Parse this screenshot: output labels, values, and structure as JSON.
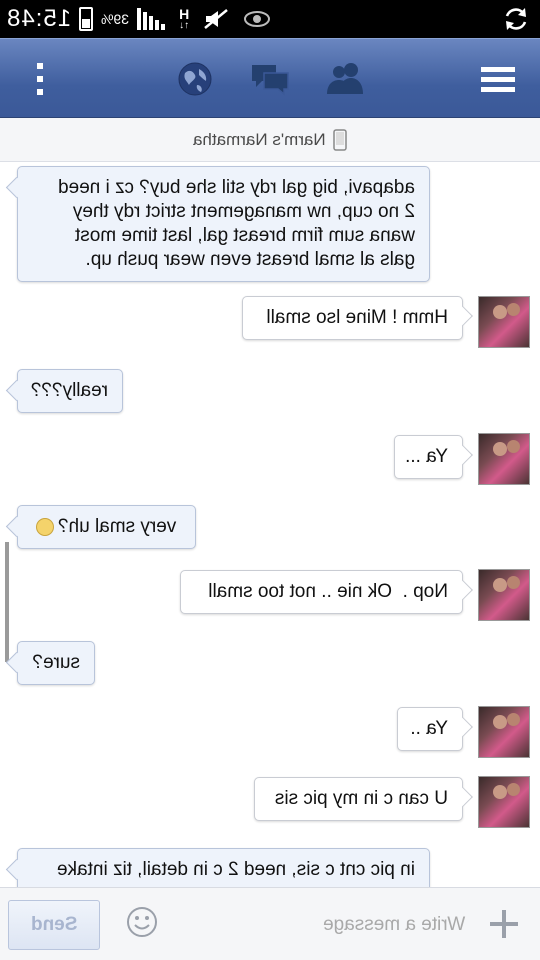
{
  "status_bar": {
    "time": "15:48",
    "battery_percent": "39%",
    "network": "H"
  },
  "thread": {
    "title": "Narm's Narmatha"
  },
  "messages": [
    {
      "direction": "incoming",
      "text": "adapavi, big gal rdy stil she buy? cz i need\n2 no cup, nw management strict rdy they\nwana sum firm breast gal, last time most\ngals al smal breast even wear push up."
    },
    {
      "direction": "outgoing",
      "text": "Hmm ! Mine lso small"
    },
    {
      "direction": "incoming",
      "text": "really???"
    },
    {
      "direction": "outgoing",
      "text": "Ya ..."
    },
    {
      "direction": "incoming",
      "text": "very smal uh?"
    },
    {
      "direction": "outgoing",
      "text": "Nop .  Ok nie .. not too small"
    },
    {
      "direction": "incoming",
      "text": "sure?"
    },
    {
      "direction": "outgoing",
      "text": "Ya .."
    },
    {
      "direction": "outgoing",
      "text": "U can c in my pic sis"
    },
    {
      "direction": "incoming",
      "text": "in pic cnt c sis, need 2 c in detail, tiz intake"
    }
  ],
  "composer": {
    "placeholder": "Write a message",
    "send_label": "Send"
  },
  "icons": {
    "nav": [
      "more-icon",
      "globe-icon",
      "messages-icon",
      "friends-icon",
      "menu-icon"
    ],
    "status": [
      "sync-icon",
      "eye-icon",
      "mute-icon"
    ]
  },
  "colors": {
    "nav_bar": "#3b5998",
    "incoming_bubble": "#eef3fb"
  }
}
